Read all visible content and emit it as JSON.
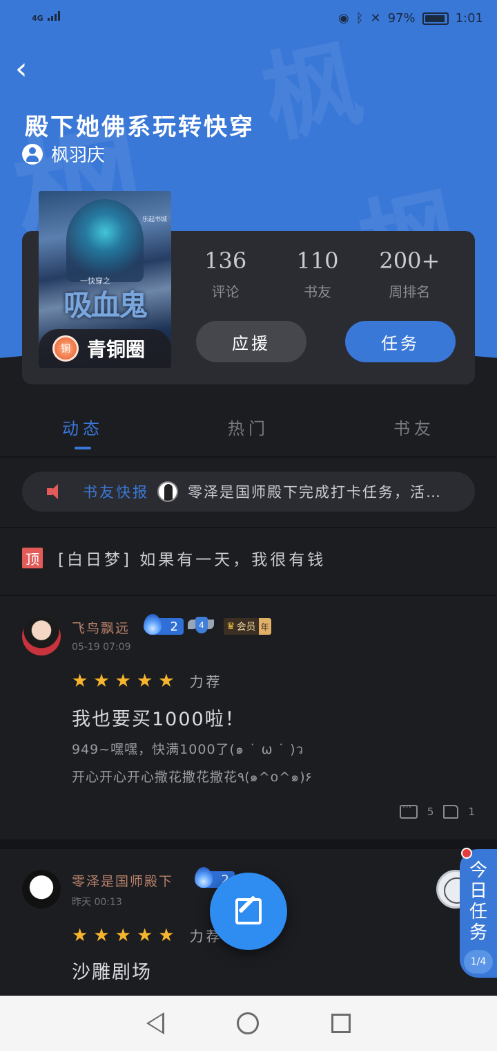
{
  "status": {
    "network": "4G",
    "battery": "97%",
    "time": "1:01"
  },
  "header": {
    "title": "殿下她佛系玩转快穿",
    "author": "枫羽庆",
    "watermark": "枫"
  },
  "book": {
    "cover_title": "吸血鬼",
    "cover_subtitle": "一快穿之",
    "cover_publisher": "乐起书城",
    "level_badge": "青铜圈",
    "level_icon_text": "铜"
  },
  "stats": [
    {
      "value": "136",
      "label": "评论"
    },
    {
      "value": "110",
      "label": "书友"
    },
    {
      "value": "200+",
      "label": "周排名"
    }
  ],
  "buttons": {
    "support": "应援",
    "task": "任务"
  },
  "tabs": [
    {
      "label": "动态",
      "active": true
    },
    {
      "label": "热门",
      "active": false
    },
    {
      "label": "书友",
      "active": false
    }
  ],
  "news": {
    "label": "书友快报",
    "text": "零泽是国师殿下完成打卡任务，活…"
  },
  "pinned": {
    "tag": "顶",
    "text": "[白日梦] 如果有一天，我很有钱"
  },
  "posts": [
    {
      "username": "飞鸟飘远",
      "date": "05-19 07:09",
      "fire_level": "2",
      "shield_level": "4",
      "vip_label": "会员",
      "vip_year": "年",
      "rating_label": "力荐",
      "headline": "我也要买1000啦！",
      "body_line1": "949~嘿嘿，快满1000了(๑ ˙ ω ˙ )ว",
      "body_line2": "开心开心开心撒花撒花撒花٩(๑^o^๑)۶",
      "comments": "5",
      "likes": "1"
    },
    {
      "username": "零泽是国师殿下",
      "date": "昨天 00:13",
      "fire_level": "2",
      "rating_label": "力荐",
      "headline": "沙雕剧场"
    }
  ],
  "daily_task": {
    "label": "今日任务",
    "progress": "1/4"
  }
}
